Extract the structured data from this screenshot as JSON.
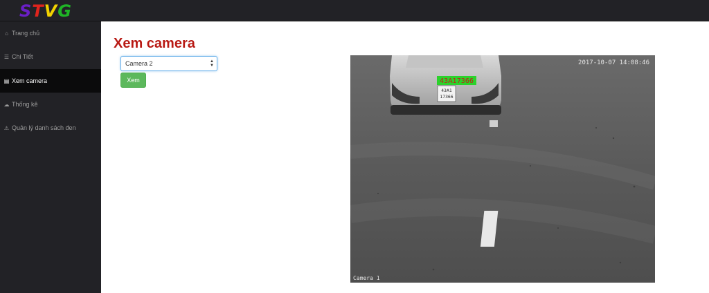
{
  "brand": {
    "letters": [
      {
        "char": "S",
        "color": "#6a1fc7"
      },
      {
        "char": "T",
        "color": "#e0241d"
      },
      {
        "char": "V",
        "color": "#f2d200"
      },
      {
        "char": "G",
        "color": "#1fb526"
      }
    ]
  },
  "sidebar": {
    "items": [
      {
        "label": "Trang chủ",
        "icon": "home-icon",
        "glyph": "⌂",
        "active": false
      },
      {
        "label": "Chi Tiết",
        "icon": "list-icon",
        "glyph": "☰",
        "active": false
      },
      {
        "label": "Xem camera",
        "icon": "document-icon",
        "glyph": "▤",
        "active": true
      },
      {
        "label": "Thống kê",
        "icon": "cloud-icon",
        "glyph": "☁",
        "active": false
      },
      {
        "label": "Quản lý danh sách đen",
        "icon": "warning-icon",
        "glyph": "⚠",
        "active": false
      }
    ]
  },
  "main": {
    "title": "Xem camera",
    "camera_select": {
      "selected": "Camera 2"
    },
    "view_button": "Xem"
  },
  "camera": {
    "timestamp": "2017-10-07 14:08:46",
    "plate_text": "43A17366",
    "plate_physical": "43A1 17366",
    "label": "Camera 1"
  },
  "colors": {
    "accent_title": "#b81a14",
    "button_green": "#5cb85c",
    "sidebar_bg": "#222226",
    "plate_highlight": "#2bd22b"
  }
}
